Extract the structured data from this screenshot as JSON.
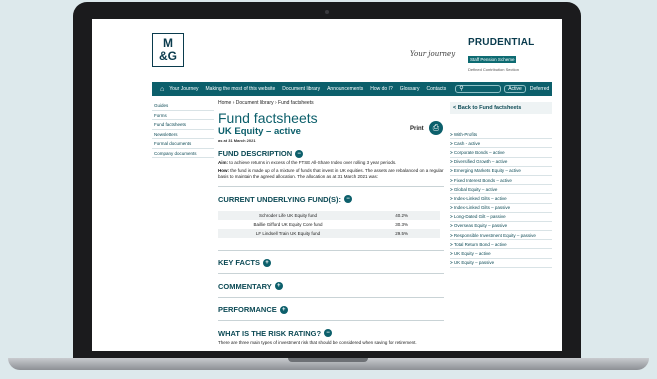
{
  "header": {
    "logo_line1": "M",
    "logo_line2": "&G",
    "tagline": "Your journey",
    "brand": "PRUDENTIAL",
    "brand_sub": "Staff Pension Scheme",
    "brand_sub2": "Defined Contribution Section"
  },
  "nav": {
    "home_icon": "home-icon",
    "items": [
      "Your Journey",
      "Making the most of this website",
      "Document library",
      "Announcements",
      "How do I?",
      "Glossary",
      "Contacts"
    ],
    "search_placeholder": "",
    "active_label": "Active",
    "deferred_label": "Deferred"
  },
  "left_sidebar": [
    "Guides",
    "Forms",
    "Fund factsheets",
    "Newsletters",
    "Formal documents",
    "Company documents"
  ],
  "main": {
    "breadcrumb": "Home › Document library › Fund factsheets",
    "page_title": "Fund factsheets",
    "fund_title": "UK Equity – active",
    "date": "as at 31 March 2021",
    "print_label": "Print",
    "fund_description": {
      "heading": "FUND DESCRIPTION",
      "aim_label": "Aim:",
      "aim_text": "to achieve returns in excess of the FTSE All-Share Index over rolling 3 year periods.",
      "how_label": "How:",
      "how_text": "the fund is made up of a mixture of funds that invest in UK equities. The assets are rebalanced on a regular basis to maintain the agreed allocation. The allocation as at 31 March 2021 was:"
    },
    "underlying": {
      "heading": "CURRENT UNDERLYING FUND(S):",
      "rows": [
        {
          "name": "Schroder Life UK Equity fund",
          "pct": "40.2%"
        },
        {
          "name": "Baillie Gifford UK Equity Core fund",
          "pct": "30.3%"
        },
        {
          "name": "LF Lindsell Train UK Equity fund",
          "pct": "29.5%"
        }
      ]
    },
    "key_facts": "KEY FACTS",
    "commentary": "COMMENTARY",
    "performance": "PERFORMANCE",
    "risk": {
      "heading": "WHAT IS THE RISK RATING?",
      "text": "There are three main types of investment risk that should be considered when saving for retirement."
    }
  },
  "right_sidebar": {
    "back_label": "< Back to Fund factsheets",
    "links": [
      "With-Profits",
      "Cash - active",
      "Corporate Bonds – active",
      "Diversified Growth – active",
      "Emerging Markets Equity – active",
      "Fixed Interest Bonds – active",
      "Global Equity – active",
      "Index-Linked Gilts – active",
      "Index-Linked Gilts – passive",
      "Long-Dated Gilt – passive",
      "Overseas Equity – passive",
      "Responsible Investment Equity – passive",
      "Total Return Bond – active",
      "UK Equity – active",
      "UK Equity – passive"
    ]
  }
}
